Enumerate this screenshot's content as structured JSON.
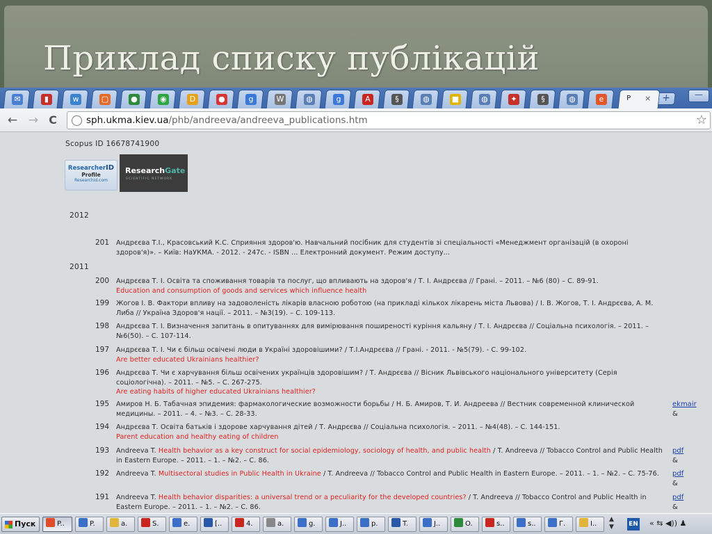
{
  "slide": {
    "title": "Приклад списку публікацій"
  },
  "browser": {
    "tabs_icon_names": [
      "gmail-icon",
      "book-icon",
      "wiki-icon",
      "tab-icon",
      "maps-icon",
      "chrome-icon",
      "doc-icon",
      "opera-icon",
      "google-icon",
      "wikipedia-icon",
      "globe-icon",
      "google-icon",
      "acrobat-icon",
      "dna-icon",
      "globe-icon",
      "yellow-icon",
      "globe-icon",
      "shield-icon",
      "dna-icon",
      "globe-icon",
      "edge-icon"
    ],
    "active_tab": {
      "label": "P",
      "close": "×"
    },
    "new_tab": "+",
    "minimize": "—",
    "nav": {
      "back": "←",
      "forward": "→",
      "reload": "C"
    },
    "url": {
      "host": "sph.ukma.kiev.ua",
      "path": "/phb/andreeva/andreeva_publications.htm"
    },
    "bookmark": "☆"
  },
  "page": {
    "scopus": "Scopus ID 16678741900",
    "researcherid": {
      "l1a": "Researcher",
      "l1b": "ID",
      "l2": "Profile",
      "l3": "Researchid.com"
    },
    "researchgate": {
      "a": "Research",
      "b": "Gate",
      "sub": "SCIENTIFIC NETWORK"
    },
    "year_2012": "2012",
    "year_2011": "2011",
    "entries": [
      {
        "num": "201",
        "text": "Андрєєва Т.І., Красовський К.С. Сприяння здоров'ю. Навчальний посібник для студентів зі спеціальності «Менеджмент організацій (в охороні здоров'я)». – Київ: НаУКМА. - 2012. - 247с. - ISBN ... Електронний документ. Режим доступу..."
      },
      {
        "num": "200",
        "text": "Андрєєва Т. І. Освіта та споживання товарів та послуг, що впливають на здоров'я / Т. І. Андрєєва // Грані. – 2011. – №6 (80) – С. 89-91.",
        "red": "Education and consumption of goods and services which influence health"
      },
      {
        "num": "199",
        "text": "Жогов І. В. Фактори впливу на задоволеність лікарів власною роботою (на прикладі кількох лікарень міста Львова) / І. В. Жогов, Т. І. Андрєєва, А. М. Либа // Україна Здоров'я нації. – 2011. – №3(19). – С. 109-113."
      },
      {
        "num": "198",
        "text": "Андрєєва Т. І. Визначення запитань в опитуваннях для вимірювання поширеності куріння кальяну / Т. І. Андрєєва // Соціальна психологія. – 2011. – №6(50). – С. 107-114."
      },
      {
        "num": "197",
        "text": "Андрєєва Т. І. Чи є більш освічені люди в Україні здоровішими? / Т.І.Андрєєва // Грані. - 2011. - №5(79). - С. 99-102.",
        "red": "Are better educated Ukrainians healthier?"
      },
      {
        "num": "196",
        "text": "Андрєєва Т. Чи є харчування більш освічених українців здоровішим? / Т. Андрєєва // Вісник Львівського національного університету (Серія соціологічна). – 2011. – №5. – С. 267-275.",
        "red": "Are eating habits of higher educated Ukrainians healthier?"
      },
      {
        "num": "195",
        "text": "Амиров Н. Б. Табачная эпидемия: фармакологические возможности борьбы / Н. Б. Амиров, Т. И. Андреева // Вестник современной клинической медицины. – 2011. – 4. – №3. – С. 28-33.",
        "link": "ekmair",
        "amp": "&"
      },
      {
        "num": "194",
        "text": "Андрєєва Т. Освіта батьків і здорове харчування дітей / Т. Андрєєва // Соціальна психологія. – 2011. – №4(48). – С. 144-151.",
        "red": "Parent education and healthy eating of children"
      },
      {
        "num": "193",
        "pre": "Andreeva T. ",
        "redinline": "Health behavior as a key construct for social epidemiology, sociology of health, and public health",
        "post": " / T. Andreeva // Tobacco Control and Public Health in Eastern Europe. – 2011. – 1. – №2. – С. 86.",
        "link": "pdf",
        "amp": "&"
      },
      {
        "num": "192",
        "pre": "Andreeva T. ",
        "redinline": "Multisectoral studies in Public Health in Ukraine",
        "post": " / T. Andreeva // Tobacco Control and Public Health in Eastern Europe. – 2011. – 1. – №2. – С. 75-76.",
        "link": "pdf",
        "amp": "&"
      },
      {
        "num": "191",
        "pre": "Andreeva T. ",
        "redinline": "Health behavior disparities: a universal trend or a peculiarity for the developed countries?",
        "post": " / T. Andreeva // Tobacco Control and Public Health in Eastern Europe. – 2011. – 1. – №2. – С. 86.",
        "link": "pdf",
        "amp": "&"
      }
    ]
  },
  "taskbar": {
    "start": "Пуск",
    "tasks": [
      "P..",
      "P.",
      "a.",
      "S.",
      "e.",
      "[..",
      "4.",
      "a.",
      "g.",
      "J..",
      "p.",
      "T.",
      "J..",
      "O.",
      "s..",
      "s..",
      "Г.",
      "I.."
    ],
    "lang": "EN",
    "tray": "« ⇆ ◀)) ♟"
  },
  "colors": {
    "accent_red": "#e02020",
    "link_blue": "#1b3ea8",
    "tab_blue": "#3d67a9"
  }
}
